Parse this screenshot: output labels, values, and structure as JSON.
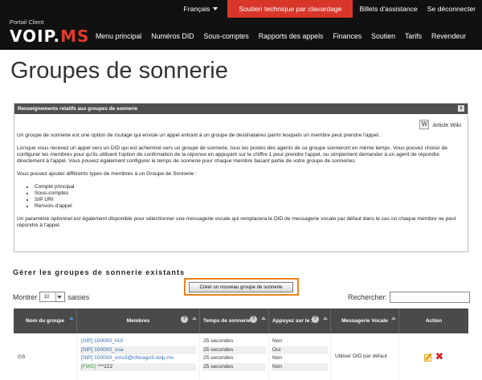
{
  "topmenu": {
    "language": "Français",
    "support": "Soutien technique par clavardage",
    "tickets": "Billets d'assistance",
    "logout": "Se déconnecter"
  },
  "logo": {
    "portal": "Portail Client",
    "brand_main": "VOIP.",
    "brand_accent": "MS"
  },
  "nav": [
    "Menu principal",
    "Numéros DID",
    "Sous-comptes",
    "Rapports des appels",
    "Finances",
    "Soutien",
    "Tarifs",
    "Revendeur"
  ],
  "page_title": "Groupes de sonnerie",
  "info_panel": {
    "title": "Renseignements relatifs aux groupes de sonnerie",
    "close": "x",
    "wiki_icon": "W",
    "wiki_label": "Article Wiki",
    "p1": "Un groupe de sonnerie est une option de routage qui envoie un appel entrant à un groupe de destinataires parmi lesquels un membre peut prendre l'appel.",
    "p2": "Lorsque vous recevez un appel vers un DID qui est acheminé vers un groupe de sonnerie, tous les postes des agents de ce groupe sonneront en même temps. Vous pouvez choisir de configurer les membres pour qu'ils utilisent l'option de confirmation de la réponse en appuyant sur le chiffre 1 pour prendre l'appel, ou simplement demander à un agent de répondre directement à l'appel. Vous pouvez également configurer le temps de sonnerie pour chaque membre faisant partie de votre groupe de sonneries.",
    "p3": "Vous pouvez ajouter différents types de membres à un Groupe de Sonnerie :",
    "list": [
      "Compte principal",
      "Sous-comptes",
      "SIP URI",
      "Renvois d'appel"
    ],
    "p4": "Un paramètre optionnel est également disponible pour sélectionner une messagerie vocale qui remplacera le DID de messagerie vocale par défaut dans le cas où chaque membre ne peut répondre à l'appel."
  },
  "section_title": "Gérer les groupes de sonnerie existants",
  "create_button": "Créer un nouveau groupe de sonnerie",
  "show": {
    "prefix": "Montrer",
    "value": "10",
    "suffix": "saisies"
  },
  "search": {
    "label": "Rechercher:",
    "value": ""
  },
  "table": {
    "headers": {
      "name": "Nom du groupe",
      "members": "Membres",
      "ring_time": "Temps de sonnerie",
      "press1": "Appuyez sur le 1",
      "voicemail": "Messagerie Vocale",
      "action": "Action"
    },
    "help": "?",
    "rows": [
      {
        "name": "GS",
        "members": [
          {
            "tag": "[SIP]",
            "value": "100000_IAX",
            "ring": "25 secondes",
            "press1": "Non"
          },
          {
            "tag": "[SIP]",
            "value": "100000_usa",
            "ring": "25 secondes",
            "press1": "Oui"
          },
          {
            "tag": "[SIP]",
            "value": "100000_sms3@chicago3.voip.ms",
            "ring": "25 secondes",
            "press1": "Non"
          },
          {
            "tag": "[FWD]",
            "value": "***222",
            "ring": "25 secondes",
            "press1": "Non"
          }
        ],
        "voicemail": "Utiliser DID par défaut"
      }
    ]
  },
  "colors": {
    "topbar": "#111111",
    "support": "#d9362a",
    "highlight": "#f0821e",
    "link": "#2f6fb5"
  }
}
